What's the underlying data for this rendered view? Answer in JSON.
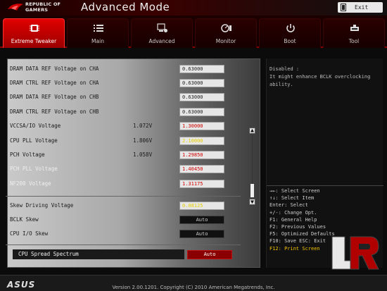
{
  "header": {
    "logo_line1": "REPUBLIC OF",
    "logo_line2": "GAMERS",
    "title": "Advanced Mode",
    "exit_label": "Exit"
  },
  "tabs": [
    {
      "label": "Extreme Tweaker",
      "icon": "chip-icon",
      "active": true
    },
    {
      "label": "Main",
      "icon": "list-icon",
      "active": false
    },
    {
      "label": "Advanced",
      "icon": "advanced-icon",
      "active": false
    },
    {
      "label": "Monitor",
      "icon": "monitor-icon",
      "active": false
    },
    {
      "label": "Boot",
      "icon": "power-icon",
      "active": false
    },
    {
      "label": "Tool",
      "icon": "tool-icon",
      "active": false
    }
  ],
  "settings": [
    {
      "label": "DRAM DATA REF Voltage on CHA",
      "reading": "",
      "value": "0.63000",
      "style": "normal"
    },
    {
      "label": "DRAM CTRL REF Voltage on CHA",
      "reading": "",
      "value": "0.63000",
      "style": "normal"
    },
    {
      "label": "DRAM DATA REF Voltage on CHB",
      "reading": "",
      "value": "0.63000",
      "style": "normal"
    },
    {
      "label": "DRAM CTRL REF Voltage on CHB",
      "reading": "",
      "value": "0.63000",
      "style": "normal"
    },
    {
      "label": "VCCSA/IO Voltage",
      "reading": "1.072V",
      "value": "1.30000",
      "style": "red"
    },
    {
      "label": "CPU PLL Voltage",
      "reading": "1.806V",
      "value": "2.10000",
      "style": "yellow"
    },
    {
      "label": "PCH Voltage",
      "reading": "1.058V",
      "value": "1.29850",
      "style": "red"
    },
    {
      "label": "PCH PLL Voltage",
      "reading": "",
      "value": "1.40450",
      "style": "red"
    },
    {
      "label": "NF200 Voltage",
      "reading": "",
      "value": "1.31175",
      "style": "red"
    },
    {
      "label": "Skew Driving Voltage",
      "reading": "",
      "value": "0.08125",
      "style": "yellow"
    },
    {
      "label": "BCLK Skew",
      "reading": "",
      "value": "Auto",
      "style": "auto"
    },
    {
      "label": "CPU I/O Skew",
      "reading": "",
      "value": "Auto",
      "style": "auto"
    }
  ],
  "selected_setting": {
    "label": "CPU Spread Spectrum",
    "value": "Auto"
  },
  "help": {
    "description": "Disabled :\nIt might enhance BCLK overclocking ability."
  },
  "keys": [
    "→←: Select Screen",
    "↑↓: Select Item",
    "Enter: Select",
    "+/-: Change Opt.",
    "F1: General Help",
    "F2: Previous Values",
    "F5: Optimized Defaults",
    "F10: Save  ESC: Exit",
    "F12: Print Screen"
  ],
  "footer": {
    "brand": "ASUS",
    "version": "Version 2.00.1201. Copyright (C) 2010 American Megatrends, Inc."
  },
  "colors": {
    "accent": "#d00000",
    "highlight": "#f2c200"
  }
}
